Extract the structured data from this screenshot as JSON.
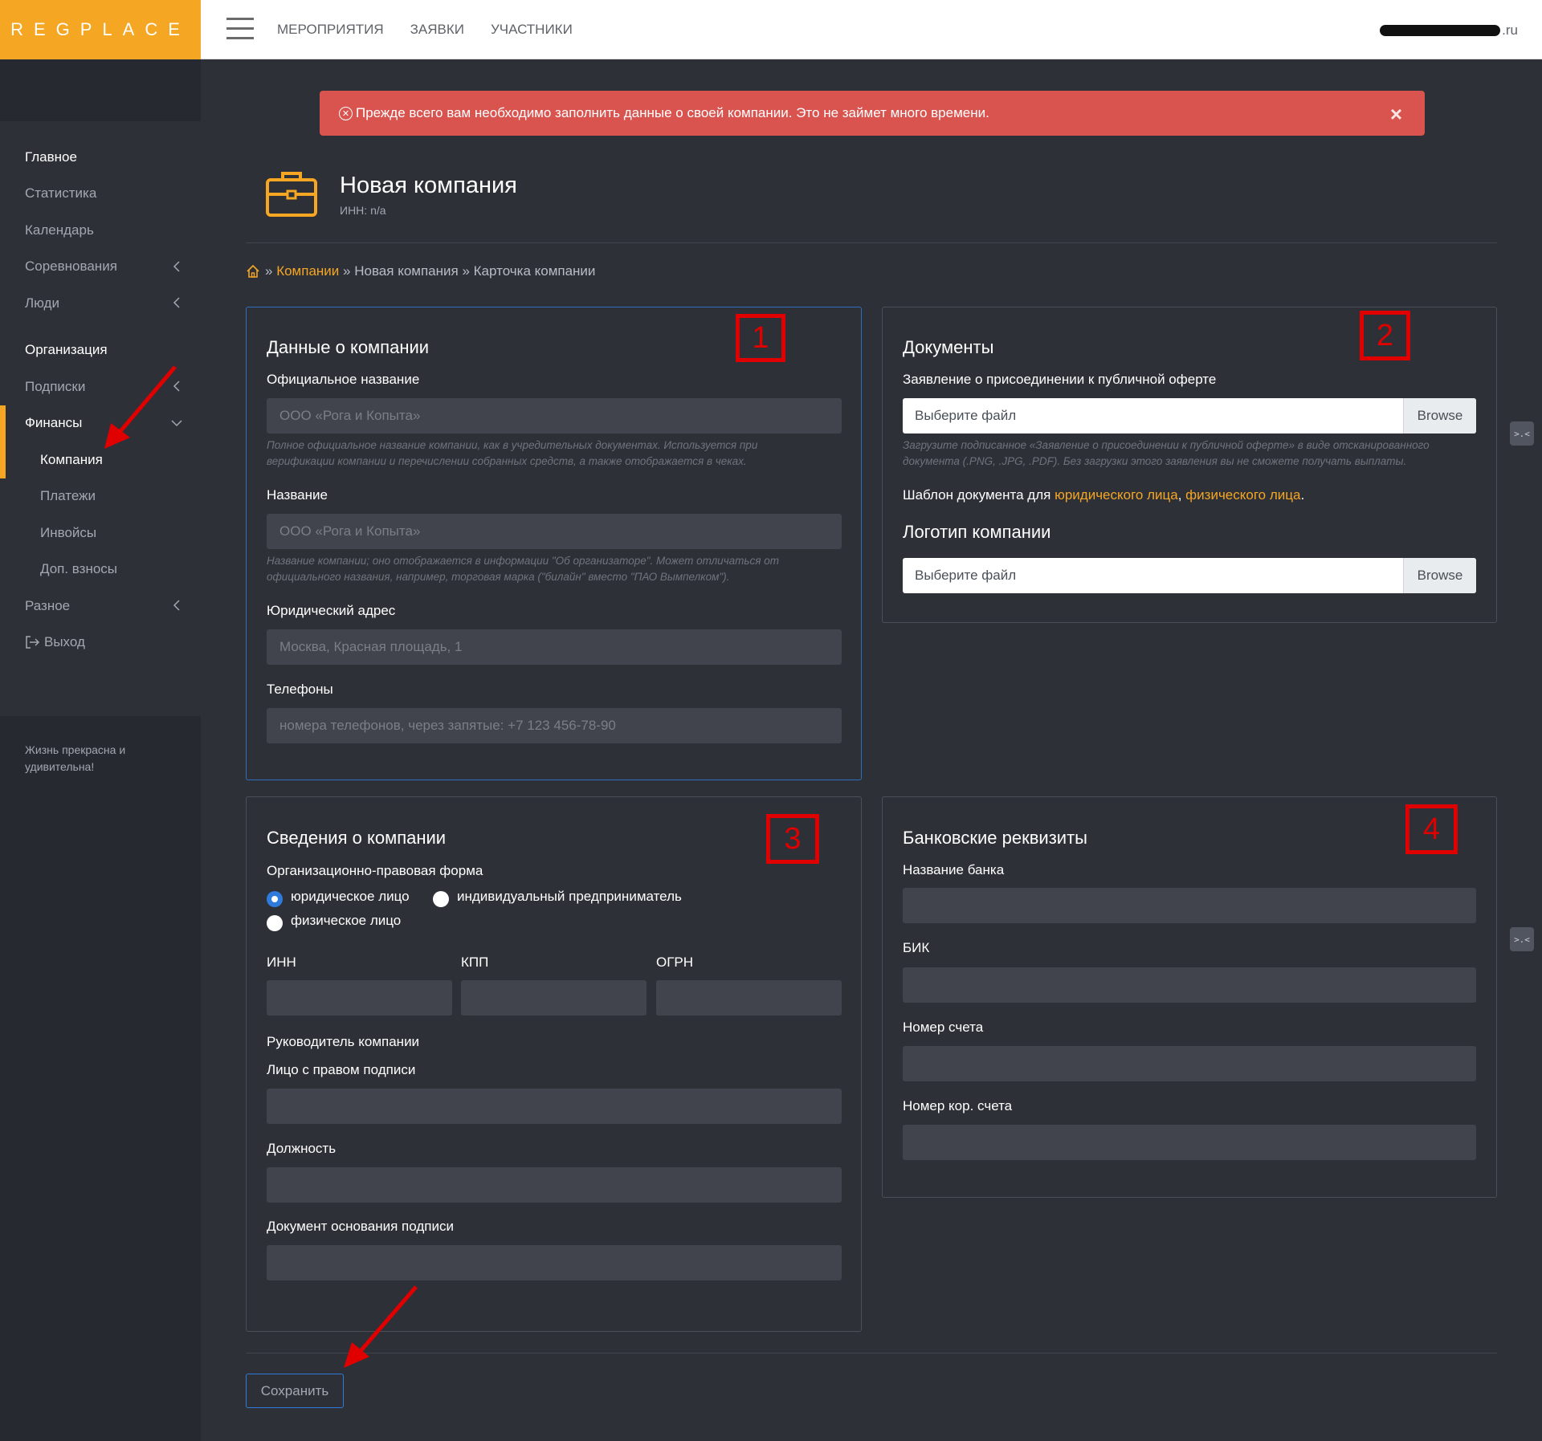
{
  "topbar": {
    "logo": "REGPLACE",
    "nav": [
      "МЕРОПРИЯТИЯ",
      "ЗАЯВКИ",
      "УЧАСТНИКИ"
    ],
    "user_email_suffix": ".ru"
  },
  "sidebar": {
    "items": [
      {
        "label": "Главное"
      },
      {
        "label": "Статистика"
      },
      {
        "label": "Календарь"
      },
      {
        "label": "Соревнования"
      },
      {
        "label": "Люди"
      },
      {
        "label": "Организация"
      },
      {
        "label": "Подписки"
      },
      {
        "label": "Финансы"
      },
      {
        "label": "Компания"
      },
      {
        "label": "Платежи"
      },
      {
        "label": "Инвойсы"
      },
      {
        "label": "Доп. взносы"
      },
      {
        "label": "Разное"
      },
      {
        "label": "Выход"
      }
    ],
    "motto": "Жизнь прекрасна и удивительна!"
  },
  "alert": {
    "text": "Прежде всего вам необходимо заполнить данные о своей компании. Это не займет много времени.",
    "close": "×"
  },
  "page": {
    "title": "Новая компания",
    "subtitle": "ИНН: n/a"
  },
  "breadcrumb": {
    "sep": "»",
    "items": [
      "Компании",
      "Новая компания",
      "Карточка компании"
    ]
  },
  "company_data": {
    "number": "1",
    "title": "Данные о компании",
    "official_name_label": "Официальное название",
    "official_name_placeholder": "ООО «Рога и Копыта»",
    "official_name_hint": "Полное официальное название компании, как в учредительных документах. Используется при верификации компании и перечислении собранных средств, а также отображается в чеках.",
    "name_label": "Название",
    "name_placeholder": "ООО «Рога и Копыта»",
    "name_hint": "Название компании; оно отображается в информации \"Об организаторе\". Может отличаться от официального названия, например, торговая марка (\"билайн\" вместо \"ПАО Вымпелком\").",
    "address_label": "Юридический адрес",
    "address_placeholder": "Москва, Красная площадь, 1",
    "phones_label": "Телефоны",
    "phones_placeholder": "номера телефонов, через запятые: +7 123 456-78-90"
  },
  "documents": {
    "number": "2",
    "title": "Документы",
    "offer_label": "Заявление о присоединении к публичной оферте",
    "file_placeholder": "Выберите файл",
    "browse": "Browse",
    "offer_hint": "Загрузите подписанное «Заявление о присоединении к публичной оферте» в виде отсканированного документа (.PNG, .JPG, .PDF). Без загрузки этого заявления вы не сможете получать выплаты.",
    "template_prefix": "Шаблон документа для",
    "template_legal": "юридического лица",
    "template_comma": ",",
    "template_physical": "физического лица",
    "template_dot": ".",
    "logo_title": "Логотип компании"
  },
  "company_info": {
    "number": "3",
    "title": "Сведения о компании",
    "legal_form_label": "Организационно-правовая форма",
    "radio_legal": "юридическое лицо",
    "radio_ip": "индивидуальный предприниматель",
    "radio_physical": "физическое лицо",
    "inn_label": "ИНН",
    "kpp_label": "КПП",
    "ogrn_label": "ОГРН",
    "head_label": "Руководитель компании",
    "signer_label": "Лицо с правом подписи",
    "position_label": "Должность",
    "basis_label": "Документ основания подписи"
  },
  "bank": {
    "number": "4",
    "title": "Банковские реквизиты",
    "bank_name_label": "Название банка",
    "bik_label": "БИК",
    "account_label": "Номер счета",
    "corr_account_label": "Номер кор. счета"
  },
  "side_handle": ">.<",
  "save_button": "Сохранить",
  "colors": {
    "brand": "#f5a623",
    "alert": "#d9534f",
    "accent_blue": "#2f7bdb",
    "annotation_red": "#e00000"
  }
}
